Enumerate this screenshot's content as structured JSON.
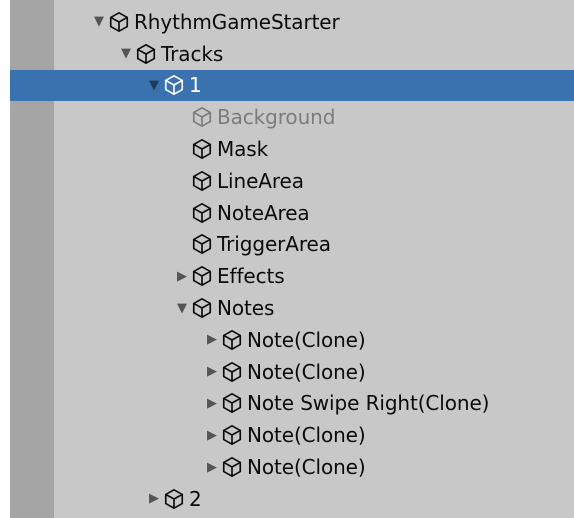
{
  "hierarchy": {
    "root": {
      "label": "RhythmGameStarter",
      "expanded": true
    },
    "tracks": {
      "label": "Tracks",
      "expanded": true
    },
    "track1": {
      "label": "1",
      "expanded": true,
      "selected": true
    },
    "background": {
      "label": "Background",
      "inactive": true
    },
    "mask": {
      "label": "Mask"
    },
    "line_area": {
      "label": "LineArea"
    },
    "note_area": {
      "label": "NoteArea"
    },
    "trigger_area": {
      "label": "TriggerArea"
    },
    "effects": {
      "label": "Effects",
      "expanded": false
    },
    "notes": {
      "label": "Notes",
      "expanded": true
    },
    "note_items": [
      {
        "label": "Note(Clone)"
      },
      {
        "label": "Note(Clone)"
      },
      {
        "label": "Note Swipe Right(Clone)"
      },
      {
        "label": "Note(Clone)"
      },
      {
        "label": "Note(Clone)"
      }
    ],
    "track2": {
      "label": "2",
      "expanded": false
    }
  },
  "icons": {
    "expanded": "triangle-down-icon",
    "collapsed": "triangle-right-icon",
    "gameobject": "cube-icon"
  },
  "colors": {
    "panel_background": "#c8c8c8",
    "gutter": "#a5a5a5",
    "selection": "#3a72b0",
    "inactive_text": "#7c7c7c"
  }
}
